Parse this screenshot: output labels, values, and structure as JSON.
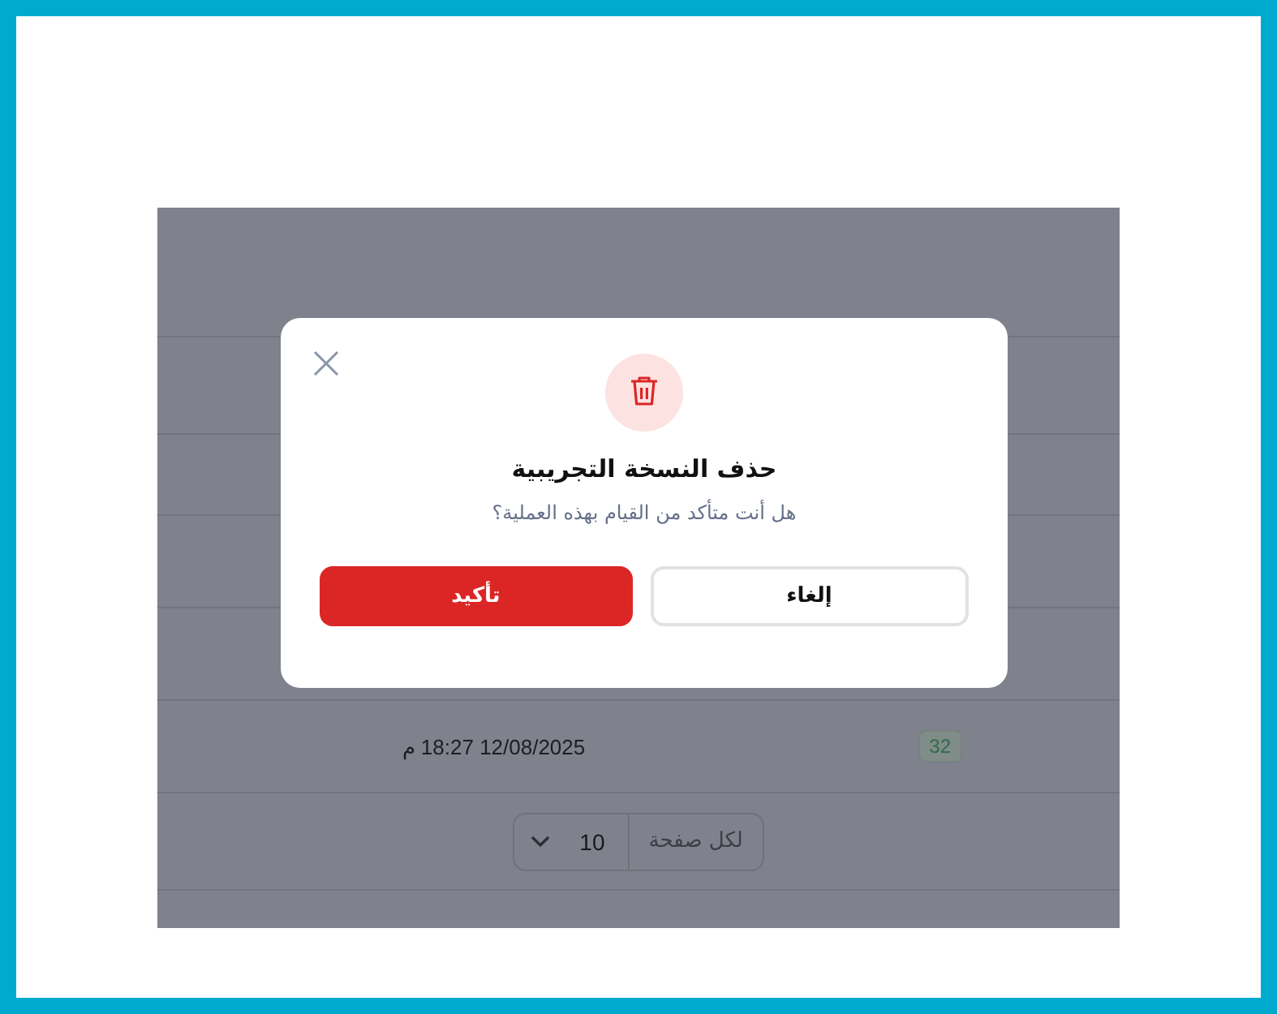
{
  "background_table": {
    "rows": [
      {
        "date": "12/08/2025 18:27 م",
        "count": "32"
      }
    ]
  },
  "pagination": {
    "per_page_label": "لكل صفحة",
    "value": "10"
  },
  "dialog": {
    "title": "حذف النسخة التجريبية",
    "message": "هل أنت متأكد من القيام بهذه العملية؟",
    "buttons": [
      {
        "label": "إلغاء",
        "kind": "cancel"
      },
      {
        "label": "تأكيد",
        "kind": "confirm"
      }
    ]
  }
}
